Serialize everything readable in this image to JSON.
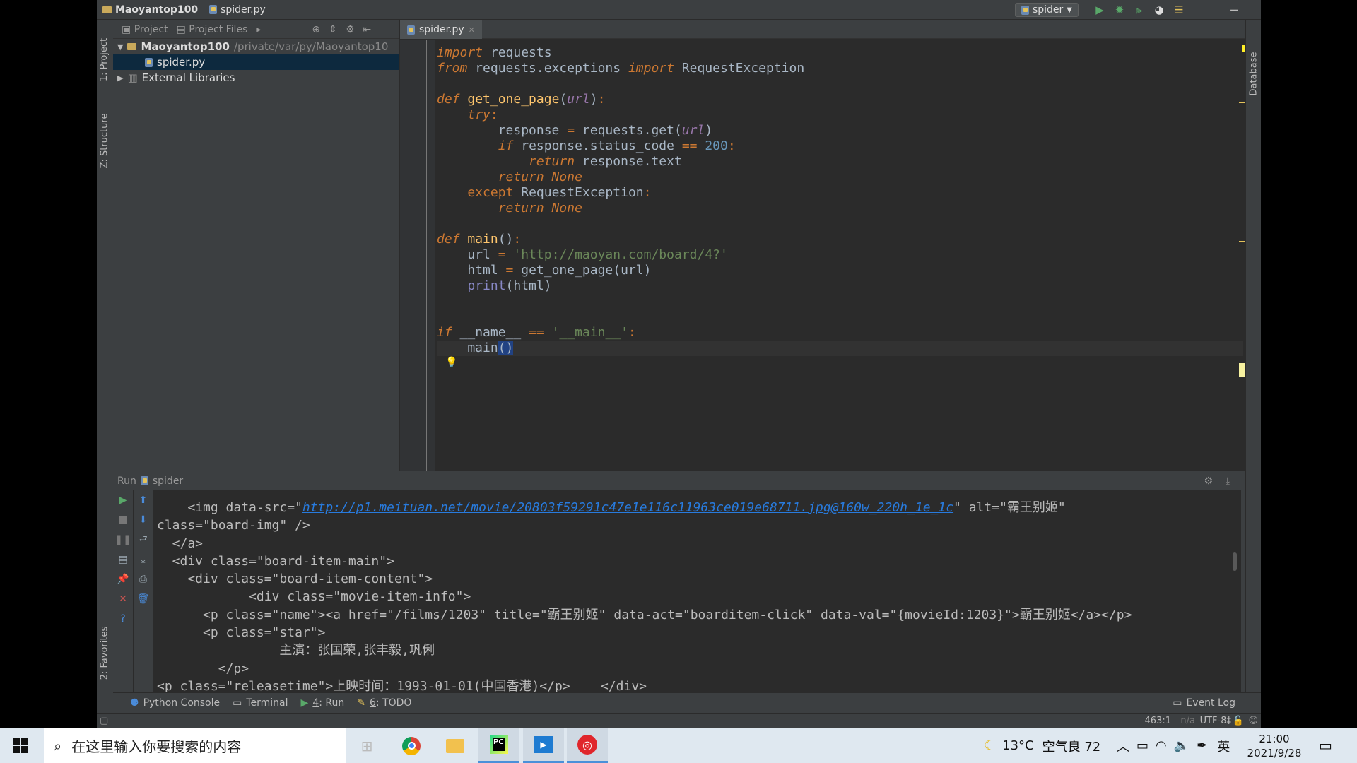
{
  "titlebar": {
    "project": "Maoyantop100",
    "file": "spider.py",
    "run_config": "spider"
  },
  "left_tool_windows": {
    "project_tab": "1: Project",
    "structure_tab": "Z: Structure",
    "favorites_tab": "2: Favorites"
  },
  "right_tool_windows": {
    "database_tab": "Database"
  },
  "project_panel": {
    "view_project": "Project",
    "view_project_files": "Project Files",
    "root_name": "Maoyantop100",
    "root_path": "/private/var/py/Maoyantop10",
    "file_name": "spider.py",
    "external_libraries": "External Libraries"
  },
  "editor": {
    "tab_label": "spider.py"
  },
  "run_panel": {
    "title": "Run",
    "config": "spider"
  },
  "console": {
    "line2_pre": "    <img data-src=\"",
    "line2_link": "http://p1.meituan.net/movie/20803f59291c47e1e116c11963ce019e68711.jpg@160w_220h_1e_1c",
    "line2_post": "\" alt=\"霸王别姬\"",
    "line3": "class=\"board-img\" />",
    "line4": "  </a>",
    "line5": "  <div class=\"board-item-main\">",
    "line6": "    <div class=\"board-item-content\">",
    "line7": "            <div class=\"movie-item-info\">",
    "line8": "      <p class=\"name\"><a href=\"/films/1203\" title=\"霸王别姬\" data-act=\"boarditem-click\" data-val=\"{movieId:1203}\">霸王别姬</a></p>",
    "line9": "      <p class=\"star\">",
    "line10": "                主演：张国荣,张丰毅,巩俐",
    "line11": "        </p>",
    "line12": "<p class=\"releasetime\">上映时间：1993-01-01(中国香港)</p>    </div>"
  },
  "bottom_tabs": {
    "python_console": "Python Console",
    "terminal": "Terminal",
    "run_num": "4",
    "run": ": Run",
    "todo_num": "6",
    "todo": ": TODO",
    "event_log": "Event Log"
  },
  "status_bar": {
    "position": "463:1",
    "na": "n/a",
    "encoding": "UTF-8‡"
  },
  "taskbar": {
    "search_placeholder": "在这里输入你要搜索的内容",
    "weather": "13°C",
    "air_quality": "空气良 72",
    "ime": "英",
    "time": "21:00",
    "date": "2021/9/28"
  },
  "colors": {
    "keyword": "#cc7832",
    "string": "#6a8759",
    "number": "#6897bb",
    "param": "#9876aa",
    "link": "#287bde"
  }
}
